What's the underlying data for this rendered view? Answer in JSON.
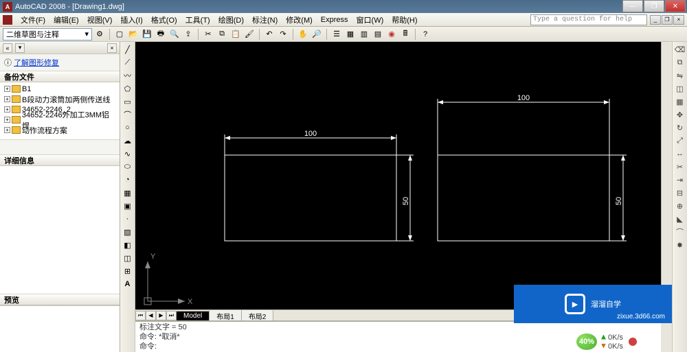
{
  "title": "AutoCAD 2008 - [Drawing1.dwg]",
  "menus": [
    "文件(F)",
    "编辑(E)",
    "视图(V)",
    "插入(I)",
    "格式(O)",
    "工具(T)",
    "绘图(D)",
    "标注(N)",
    "修改(M)",
    "Express",
    "窗口(W)",
    "帮助(H)"
  ],
  "help_placeholder": "Type a question for help",
  "workspace_combo": "二维草图与注释",
  "left_panel": {
    "link": "了解图形修复",
    "backup_title": "备份文件",
    "items": [
      "B1",
      "B段动力滚筒加两侧传送线",
      "34652-2246_2",
      "34652-2246外加工3MM铝焊.",
      "动作流程方案"
    ],
    "detail_title": "详细信息",
    "preview_title": "预览"
  },
  "tabs": {
    "model": "Model",
    "layout1": "布局1",
    "layout2": "布局2"
  },
  "cmd": {
    "l1": "标注文字 = 50",
    "l2": "命令: *取消*",
    "l3": "命令:"
  },
  "drawing": {
    "dim_top_left": "100",
    "dim_top_right": "100",
    "dim_side_left": "50",
    "dim_side_right": "50",
    "axis_x": "X",
    "axis_y": "Y"
  },
  "overlay": {
    "brand": "溜溜自学",
    "url": "zixue.3d66.com",
    "percent": "40%",
    "up": "0K/s",
    "down": "0K/s"
  }
}
